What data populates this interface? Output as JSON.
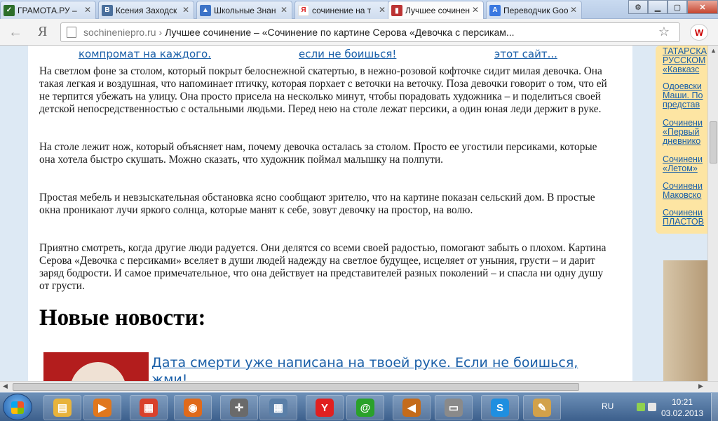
{
  "browser": {
    "tabs": [
      {
        "label": "ГРАМОТА.РУ – ",
        "icon": "gramota-icon",
        "color": "#2d6e2a"
      },
      {
        "label": "Ксения Заходск",
        "icon": "vk-icon",
        "color": "#4a6f9c"
      },
      {
        "label": "Школьные Знан",
        "icon": "znanija-icon",
        "color": "#3c73c7"
      },
      {
        "label": "сочинение на т",
        "icon": "yandex-icon",
        "color": "#d22"
      },
      {
        "label": "Лучшее сочинен",
        "icon": "book-icon",
        "color": "#b33",
        "active": true
      },
      {
        "label": "Переводчик Goo",
        "icon": "google-translate-icon",
        "color": "#3a78e0"
      }
    ],
    "address": {
      "domain": "sochineniepro.ru",
      "separator": "›",
      "title": "Лучшее сочинение – «Сочинение по картине Серова «Девочка с персикам..."
    },
    "back_glyph": "←",
    "yandex_glyph": "Я",
    "ext_glyph": "W"
  },
  "page": {
    "top_links": [
      "компромат на каждого.",
      "если не боишься!",
      "этот сайт..."
    ],
    "paragraphs": [
      "На светлом фоне за столом, который покрыт белоснежной скатертью, в нежно-розовой кофточке сидит милая девочка. Она такая легкая и воздушная, что напоминает птичку, которая порхает с веточки на веточку. Поза девочки говорит о том, что ей не терпится убежать на улицу. Она просто присела на несколько минут, чтобы порадовать художника – и поделиться своей детской непосредственностью с остальными людьми. Перед нею на столе лежат персики, а один юная леди держит в руке.",
      "На столе лежит нож, который объясняет нам, почему девочка осталась за столом. Просто ее угостили персиками, которые она хотела быстро скушать. Можно сказать, что художник поймал малышку на полпути.",
      "Простая мебель и невзыскательная обстановка ясно сообщают зрителю, что на картине показан сельский дом. В простые окна проникают лучи яркого солнца, которые манят к себе, зовут девочку на простор, на волю.",
      "Приятно смотреть, когда другие люди радуется. Они делятся со всеми своей радостью, помогают забыть о плохом. Картина Серова «Девочка с персиками» вселяет в души людей надежду на светлое будущее, исцеляет от уныния, грусти – и дарит заряд бодрости. И самое примечательное, что она действует на представителей разных поколений – и спасла ни одну душу от грусти."
    ],
    "news_heading": "Новые новости:",
    "news_link": "Дата смерти уже написана на твоей руке. Если не боишься, жми!",
    "sidebar_links": [
      [
        "ТАТАРСКА",
        "РУССКОМ",
        "«Кавказс"
      ],
      [
        "Одоевски",
        "Маши. По",
        "представ"
      ],
      [
        "Сочинени",
        "«Первый",
        "дневнико"
      ],
      [
        "Сочинени",
        "«Летом»"
      ],
      [
        "Сочинени",
        "Маковско"
      ],
      [
        "Сочинени",
        "ПЛАСТОВ"
      ]
    ]
  },
  "taskbar": {
    "items": [
      {
        "name": "explorer-icon",
        "glyph": "▤",
        "color": "#e8b33c"
      },
      {
        "name": "media-player-icon",
        "glyph": "▶",
        "color": "#e0771d"
      },
      {
        "name": "paint-icon",
        "glyph": "▦",
        "color": "#d9412c"
      },
      {
        "name": "firefox-icon",
        "glyph": "◉",
        "color": "#e06a1b"
      },
      {
        "name": "crosshair-app-icon",
        "glyph": "✛",
        "color": "#6a6a6a"
      },
      {
        "name": "calculator-icon",
        "glyph": "▦",
        "color": "#5a7fa8"
      },
      {
        "name": "yandex-browser-icon",
        "glyph": "Y",
        "color": "#e02020"
      },
      {
        "name": "agent-icon",
        "glyph": "@",
        "color": "#2aa12a"
      },
      {
        "name": "volume-icon",
        "glyph": "◀",
        "color": "#c46b1b"
      },
      {
        "name": "drive-icon",
        "glyph": "▭",
        "color": "#8a8a8a"
      },
      {
        "name": "skype-icon",
        "glyph": "S",
        "color": "#1f8fe0"
      },
      {
        "name": "palette-icon",
        "glyph": "✎",
        "color": "#d2a14a"
      }
    ],
    "lang": "RU",
    "time": "10:21",
    "date": "03.02.2013"
  }
}
